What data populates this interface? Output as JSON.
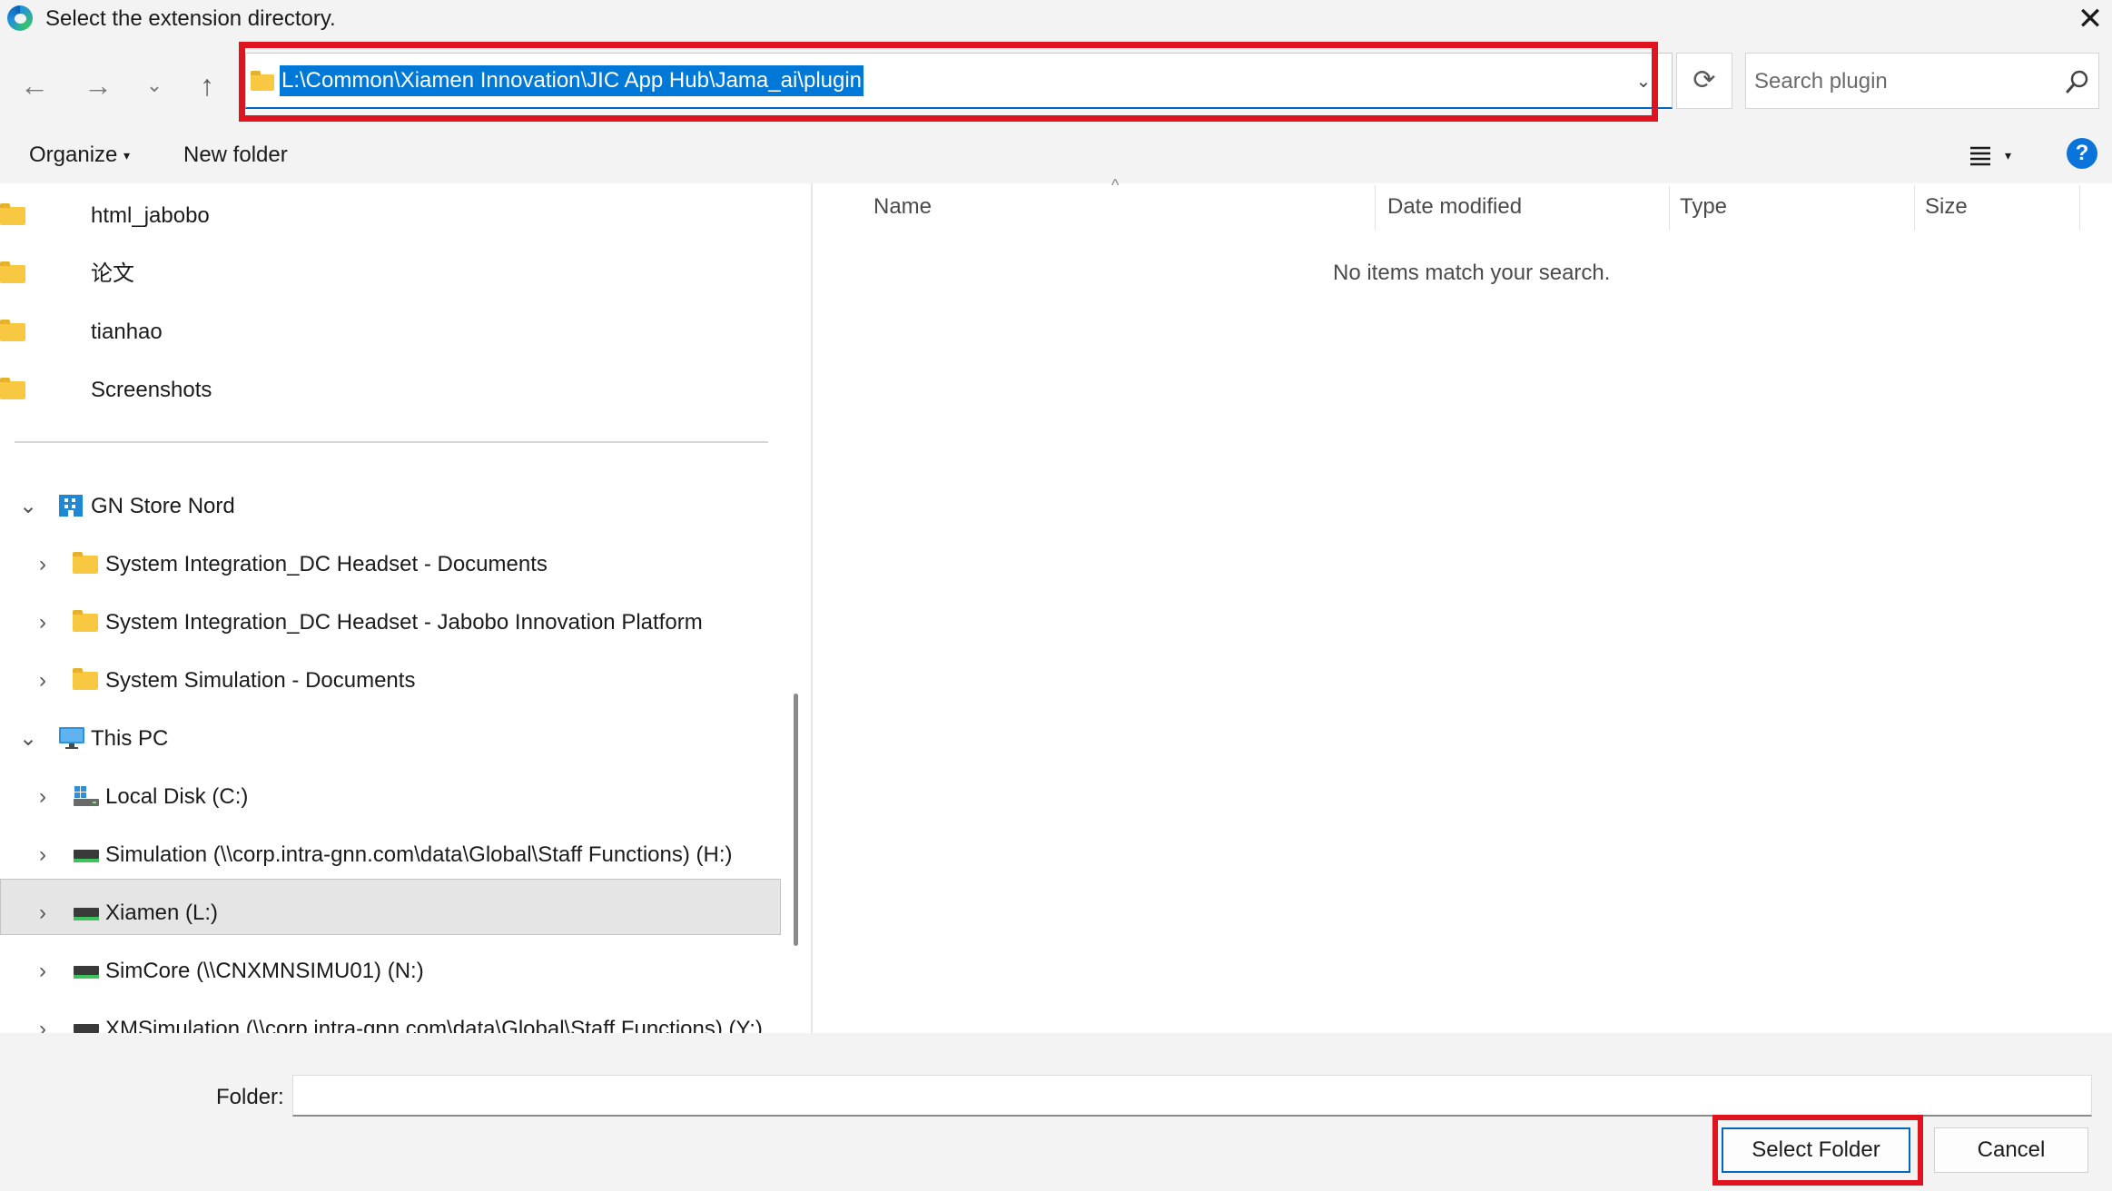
{
  "window": {
    "title": "Select the extension directory.",
    "close_glyph": "✕"
  },
  "navigation": {
    "back_glyph": "←",
    "forward_glyph": "→",
    "recent_glyph": "⌄",
    "up_glyph": "↑",
    "refresh_glyph": "⟳",
    "dropdown_glyph": "⌄"
  },
  "address_bar": {
    "path": "L:\\Common\\Xiamen Innovation\\JIC App Hub\\Jama_ai\\plugin"
  },
  "search": {
    "placeholder": "Search plugin"
  },
  "command_bar": {
    "organize_label": "Organize",
    "new_folder_label": "New folder",
    "caret_glyph": "▾",
    "help_glyph": "?"
  },
  "nav_tree": {
    "chevron_expanded": "⌄",
    "chevron_collapsed": "›",
    "items": [
      {
        "label": "html_jabobo",
        "icon": "folder-icon"
      },
      {
        "label": "论文",
        "icon": "folder-icon"
      },
      {
        "label": "tianhao",
        "icon": "folder-icon"
      },
      {
        "label": "Screenshots",
        "icon": "folder-icon"
      },
      {
        "label": "GN Store Nord",
        "icon": "building-icon",
        "expanded": true
      },
      {
        "label": "System Integration_DC Headset - Documents",
        "icon": "folder-icon"
      },
      {
        "label": "System Integration_DC Headset - Jabobo Innovation Platform",
        "icon": "folder-icon"
      },
      {
        "label": "System Simulation - Documents",
        "icon": "folder-icon"
      },
      {
        "label": "This PC",
        "icon": "monitor-icon",
        "expanded": true
      },
      {
        "label": "Local Disk (C:)",
        "icon": "local-disk-icon"
      },
      {
        "label": "Simulation (\\\\corp.intra-gnn.com\\data\\Global\\Staff Functions) (H:)",
        "icon": "network-drive-icon"
      },
      {
        "label": "Xiamen (L:)",
        "icon": "network-drive-icon",
        "selected": true
      },
      {
        "label": "SimCore (\\\\CNXMNSIMU01) (N:)",
        "icon": "network-drive-icon"
      },
      {
        "label": "XMSimulation (\\\\corp.intra-gnn.com\\data\\Global\\Staff Functions) (Y:)",
        "icon": "network-drive-icon"
      }
    ]
  },
  "file_list": {
    "columns": [
      "Name",
      "Date modified",
      "Type",
      "Size"
    ],
    "sort_glyph": "^",
    "empty_message": "No items match your search."
  },
  "footer": {
    "folder_label": "Folder:",
    "folder_value": "",
    "select_button": "Select Folder",
    "cancel_button": "Cancel"
  },
  "colors": {
    "accent": "#0067c0",
    "selection": "#0078d7",
    "highlight_box": "#e0141e",
    "chrome_bg": "#f3f3f3",
    "folder": "#f8c842"
  }
}
